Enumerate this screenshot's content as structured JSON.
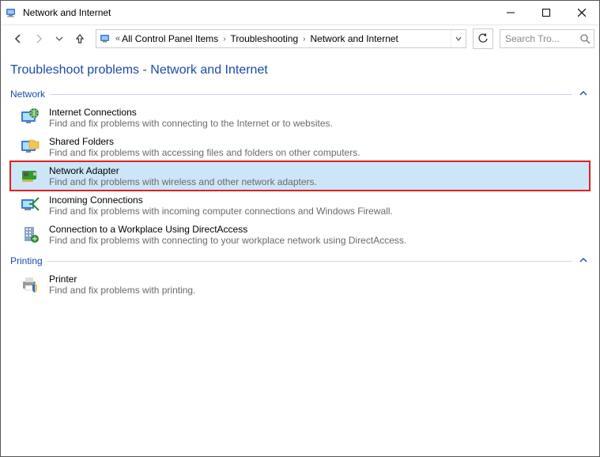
{
  "window": {
    "title": "Network and Internet"
  },
  "breadcrumb": {
    "prefix": "«",
    "parts": [
      "All Control Panel Items",
      "Troubleshooting",
      "Network and Internet"
    ]
  },
  "search": {
    "placeholder": "Search Tro..."
  },
  "page": {
    "heading": "Troubleshoot problems - Network and Internet"
  },
  "sections": [
    {
      "label": "Network",
      "items": [
        {
          "id": "internet-connections",
          "icon": "globe-monitor",
          "title": "Internet Connections",
          "desc": "Find and fix problems with connecting to the Internet or to websites.",
          "selected": false
        },
        {
          "id": "shared-folders",
          "icon": "folder-monitor",
          "title": "Shared Folders",
          "desc": "Find and fix problems with accessing files and folders on other computers.",
          "selected": false
        },
        {
          "id": "network-adapter",
          "icon": "nic-card",
          "title": "Network Adapter",
          "desc": "Find and fix problems with wireless and other network adapters.",
          "selected": true
        },
        {
          "id": "incoming-connections",
          "icon": "incoming",
          "title": "Incoming Connections",
          "desc": "Find and fix problems with incoming computer connections and Windows Firewall.",
          "selected": false
        },
        {
          "id": "directaccess",
          "icon": "building",
          "title": "Connection to a Workplace Using DirectAccess",
          "desc": "Find and fix problems with connecting to your workplace network using DirectAccess.",
          "selected": false
        }
      ]
    },
    {
      "label": "Printing",
      "items": [
        {
          "id": "printer",
          "icon": "printer-shield",
          "title": "Printer",
          "desc": "Find and fix problems with printing.",
          "selected": false
        }
      ]
    }
  ]
}
